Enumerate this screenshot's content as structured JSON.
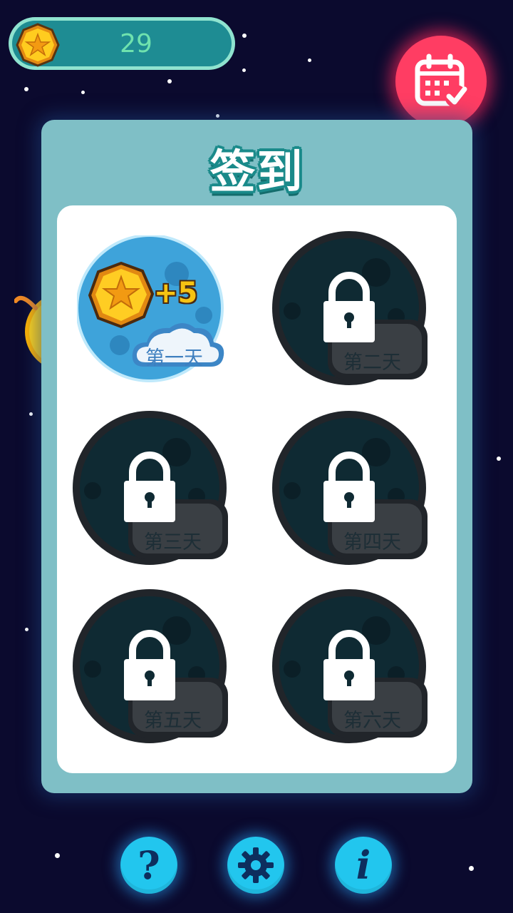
{
  "hud": {
    "coins": "29",
    "coin_icon": "coin-star-icon",
    "calendar_icon": "calendar-check-icon"
  },
  "dialog": {
    "title": "签到",
    "days": [
      {
        "label": "第一天",
        "state": "available",
        "reward": "+5"
      },
      {
        "label": "第二天",
        "state": "locked"
      },
      {
        "label": "第三天",
        "state": "locked"
      },
      {
        "label": "第四天",
        "state": "locked"
      },
      {
        "label": "第五天",
        "state": "locked"
      },
      {
        "label": "第六天",
        "state": "locked"
      }
    ]
  },
  "bottom_bar": {
    "help_glyph": "?",
    "settings_icon": "gear-icon",
    "info_glyph": "i"
  },
  "colors": {
    "background": "#0b0a2e",
    "panel": "#7fbfc6",
    "calendar_button": "#ff3d63",
    "round_button": "#22c6ee",
    "coin_count": "#6fe2ae"
  }
}
